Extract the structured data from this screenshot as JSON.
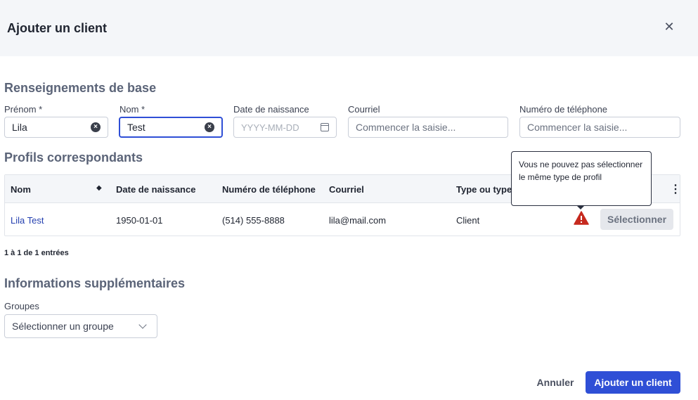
{
  "header": {
    "title": "Ajouter un client",
    "close_icon": "close-icon"
  },
  "basic": {
    "section_title": "Renseignements de base",
    "first_name": {
      "label": "Prénom *",
      "value": "Lila"
    },
    "last_name": {
      "label": "Nom *",
      "value": "Test"
    },
    "birthdate": {
      "label": "Date de naissance",
      "placeholder": "YYYY-MM-DD"
    },
    "email": {
      "label": "Courriel",
      "placeholder": "Commencer la saisie..."
    },
    "phone": {
      "label": "Numéro de téléphone",
      "placeholder": "Commencer la saisie..."
    }
  },
  "profiles": {
    "section_title": "Profils correspondants",
    "columns": [
      "Nom",
      "Date de naissance",
      "Numéro de téléphone",
      "Courriel",
      "Type ou type"
    ],
    "rows": [
      {
        "name": "Lila Test",
        "birthdate": "1950-01-01",
        "phone": "(514) 555-8888",
        "email": "lila@mail.com",
        "type": "Client",
        "action": "Sélectionner"
      }
    ],
    "tooltip": "Vous ne pouvez pas sélectionner le même type de profil",
    "entries": "1 à 1 de 1 entrées"
  },
  "extra": {
    "section_title": "Informations supplémentaires",
    "groups_label": "Groupes",
    "groups_value": "Sélectionner un groupe"
  },
  "footer": {
    "cancel": "Annuler",
    "submit": "Ajouter un client"
  },
  "colors": {
    "primary": "#2f4fd6",
    "warning": "#c62a1f",
    "link": "#2540b0"
  }
}
